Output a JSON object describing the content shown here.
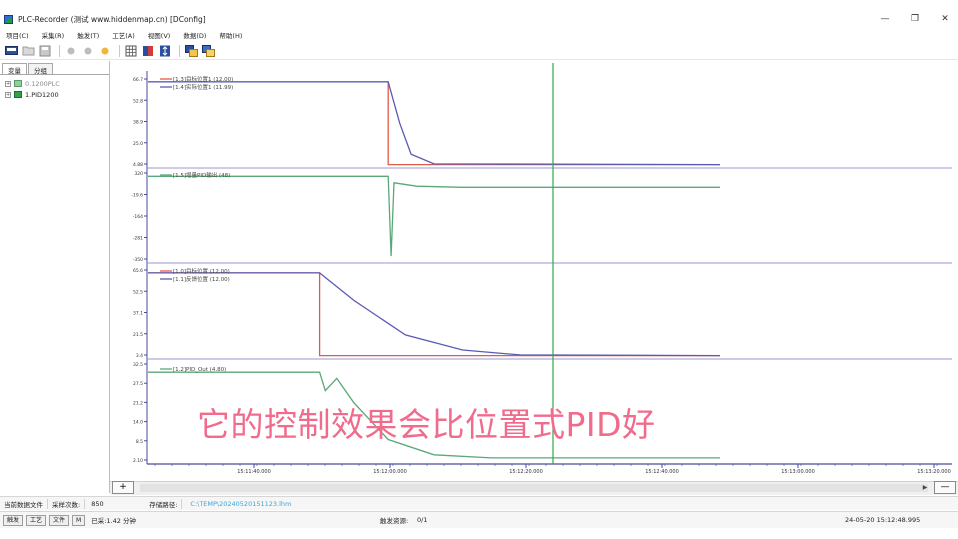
{
  "window": {
    "title": "PLC-Recorder (测试 www.hiddenmap.cn) [DConfig]",
    "controls": [
      "—",
      "❐",
      "✕"
    ]
  },
  "menu": [
    "项目(C)",
    "采集(R)",
    "触发(T)",
    "工艺(A)",
    "视图(V)",
    "数据(D)",
    "帮助(H)"
  ],
  "left_panel": {
    "tabs": [
      "变量",
      "分组"
    ],
    "tree": [
      {
        "label": "0.1200PLC",
        "expander": "+"
      },
      {
        "label": "1.PID1200",
        "expander": "+"
      }
    ]
  },
  "charts": {
    "plot1": {
      "legend": [
        "[1.3]目标位置1 (12.00)",
        "[1.4]实际位置1 (11.99)"
      ],
      "yticks": [
        "66.7",
        "52.8",
        "38.9",
        "25.0",
        "4.88"
      ]
    },
    "plot2": {
      "legend": [
        "[1.5]增量PID输出 (48)"
      ],
      "yticks": [
        "320",
        "-19.6",
        "-164",
        "-281",
        "-350"
      ]
    },
    "plot3": {
      "legend": [
        "[1.0]目标位置 (12.00)",
        "[1.1]反馈位置 (12.00)"
      ],
      "yticks": [
        "65.6",
        "52.5",
        "37.1",
        "21.5",
        "3.4"
      ]
    },
    "plot4": {
      "legend": [
        "[1.2]PID_Out (4.80)"
      ],
      "yticks": [
        "32.5",
        "27.5",
        "21.2",
        "14.0",
        "8.5",
        "2.10"
      ]
    },
    "xticks": [
      "15:11:40.000",
      "15:12:00.000",
      "15:12:20.000",
      "15:12:40.000",
      "15:13:00.000",
      "15:13:20.000"
    ]
  },
  "chart_data": [
    {
      "type": "line",
      "legend": [
        "[1.3]目标位置1 (12.00)",
        "[1.4]实际位置1 (11.99)"
      ],
      "series": [
        {
          "name": "[1.3]目标位置1",
          "points": [
            [
              0,
              12.0
            ],
            [
              0.42,
              12.0
            ],
            [
              0.42,
              0.0
            ],
            [
              1.0,
              0.0
            ]
          ]
        },
        {
          "name": "[1.4]实际位置1",
          "points": [
            [
              0,
              12.0
            ],
            [
              0.42,
              12.0
            ],
            [
              0.44,
              6.0
            ],
            [
              0.46,
              1.5
            ],
            [
              0.5,
              0.1
            ],
            [
              1.0,
              0.0
            ]
          ]
        }
      ]
    },
    {
      "type": "line",
      "legend": [
        "[1.5]增量PID输出 (48)"
      ],
      "series": [
        {
          "name": "[1.5]增量PID输出",
          "points": [
            [
              0,
              48
            ],
            [
              0.42,
              48
            ],
            [
              0.425,
              -300
            ],
            [
              0.43,
              20
            ],
            [
              0.47,
              5
            ],
            [
              0.55,
              0
            ],
            [
              1.0,
              0
            ]
          ]
        }
      ]
    },
    {
      "type": "line",
      "legend": [
        "[1.0]目标位置 (12.00)",
        "[1.1]反馈位置 (12.00)"
      ],
      "series": [
        {
          "name": "[1.0]目标位置",
          "points": [
            [
              0,
              12.0
            ],
            [
              0.3,
              12.0
            ],
            [
              0.3,
              0.0
            ],
            [
              1.0,
              0.0
            ]
          ]
        },
        {
          "name": "[1.1]反馈位置",
          "points": [
            [
              0,
              12.0
            ],
            [
              0.3,
              12.0
            ],
            [
              0.36,
              8.0
            ],
            [
              0.45,
              3.0
            ],
            [
              0.55,
              0.8
            ],
            [
              0.65,
              0.1
            ],
            [
              1.0,
              0.0
            ]
          ]
        }
      ]
    },
    {
      "type": "line",
      "legend": [
        "[1.2]PID_Out (4.80)"
      ],
      "series": [
        {
          "name": "[1.2]PID_Out",
          "points": [
            [
              0,
              30
            ],
            [
              0.3,
              30
            ],
            [
              0.31,
              24
            ],
            [
              0.33,
              28
            ],
            [
              0.36,
              20
            ],
            [
              0.42,
              8
            ],
            [
              0.5,
              3
            ],
            [
              0.6,
              2
            ],
            [
              1.0,
              2
            ]
          ]
        }
      ]
    }
  ],
  "cursor": {
    "color": "#30a84a"
  },
  "colors": {
    "red": "#e05a4a",
    "blue": "#5a5ab4",
    "green": "#5aa878",
    "axis": "#4a4a9c"
  },
  "bottom_buttons": {
    "zoom_in": "+",
    "zoom_out": "—"
  },
  "info": {
    "data_file_label": "当前数据文件",
    "sample_count_label": "采样次数:",
    "sample_count": "850",
    "save_path_label": "存储路径:",
    "save_path": "C:\\TEMP\\20240520151123.lhm"
  },
  "status": {
    "buttons": [
      "触发",
      "工艺",
      "文件",
      "M"
    ],
    "elapsed": "已采:1.42 分钟",
    "trigger_label": "触发资源:",
    "trigger_value": "0/1",
    "datetime": "24-05-20 15:12:48.995"
  },
  "subtitle": "它的控制效果会比位置式PID好"
}
